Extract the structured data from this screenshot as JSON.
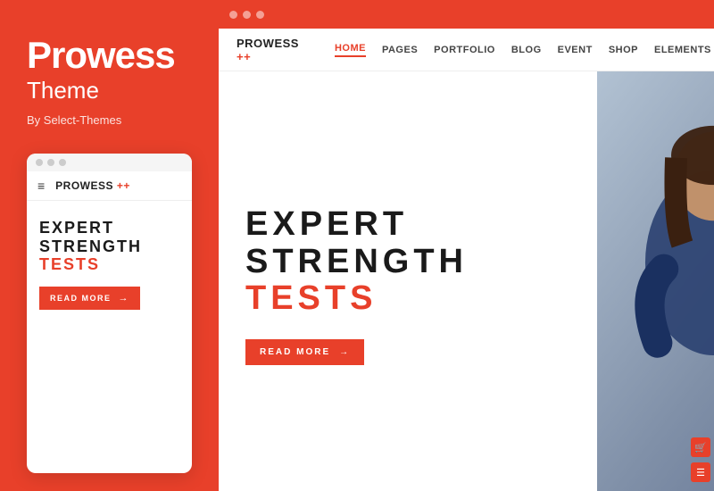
{
  "leftPanel": {
    "title": "Prowess",
    "subtitle": "Theme",
    "byLine": "By Select-Themes",
    "dots": [
      "dot1",
      "dot2",
      "dot3"
    ],
    "mobileNav": {
      "hamburger": "≡",
      "logoText": "PROWESS",
      "logoPlus": " ++"
    },
    "mobileHero": {
      "line1": "EXPERT",
      "line2": "STRENGTH",
      "accent": "TESTS",
      "buttonLabel": "READ MORE",
      "buttonArrow": "→"
    }
  },
  "rightPanel": {
    "browserDots": [
      "d1",
      "d2",
      "d3"
    ],
    "nav": {
      "logoText": "PROWESS",
      "logoPlus": " ++",
      "links": [
        {
          "label": "HOME",
          "active": true
        },
        {
          "label": "PAGES",
          "active": false
        },
        {
          "label": "PORTFOLIO",
          "active": false
        },
        {
          "label": "BLOG",
          "active": false
        },
        {
          "label": "EVENT",
          "active": false
        },
        {
          "label": "SHOP",
          "active": false
        },
        {
          "label": "ELEMENTS",
          "active": false
        }
      ]
    },
    "hero": {
      "line1": "EXPERT",
      "line2": "STRENGTH",
      "accent": "TESTS",
      "buttonLabel": "READ MORE",
      "buttonArrow": "→"
    }
  },
  "colors": {
    "accent": "#e8402a",
    "dark": "#1a1a1a",
    "white": "#ffffff"
  }
}
